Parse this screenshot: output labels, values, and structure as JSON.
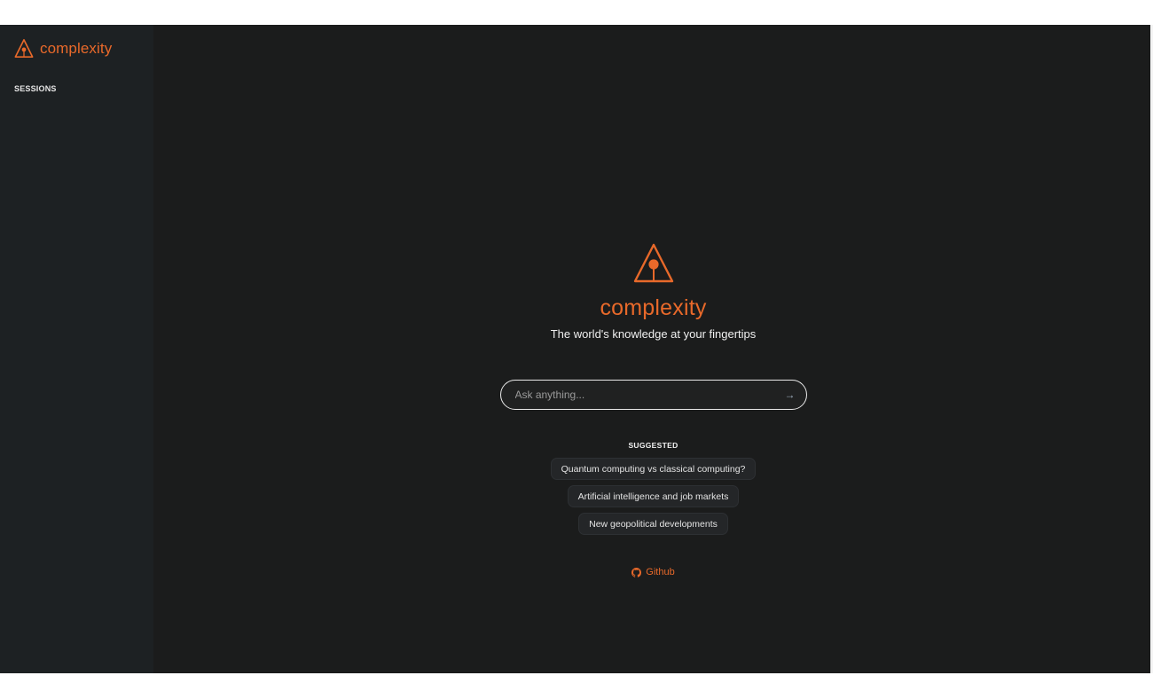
{
  "sidebar": {
    "brand_name": "complexity",
    "sessions_label": "SESSIONS"
  },
  "hero": {
    "title": "complexity",
    "tagline": "The world's knowledge at your fingertips"
  },
  "search": {
    "placeholder": "Ask anything...",
    "value": "",
    "submit_icon": "arrow-right-icon"
  },
  "suggested": {
    "label": "SUGGESTED",
    "items": [
      "Quantum computing vs classical computing?",
      "Artificial intelligence and job markets",
      "New geopolitical developments"
    ]
  },
  "footer": {
    "github_label": "Github",
    "github_icon": "github-icon"
  },
  "colors": {
    "accent": "#e8692a",
    "background": "#1b1c1c",
    "sidebar": "#1d2123"
  }
}
